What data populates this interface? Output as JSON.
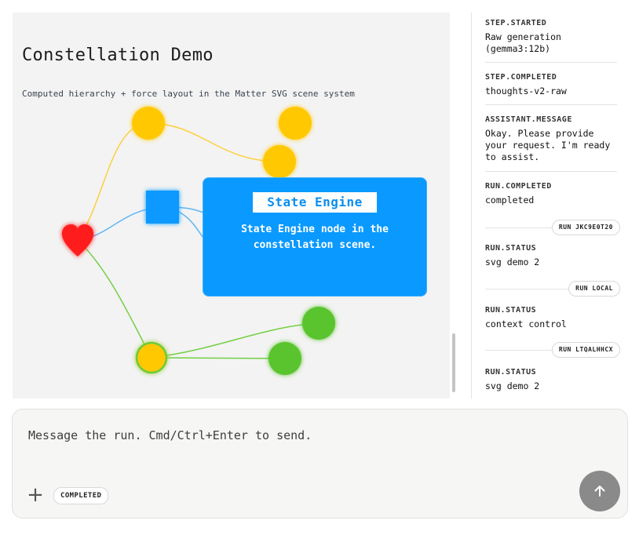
{
  "scene": {
    "title": "Constellation Demo",
    "subtitle": "Computed hierarchy + force layout in the Matter SVG scene system",
    "tooltip": {
      "title": "State Engine",
      "body": "State Engine node in the constellation scene."
    },
    "colors": {
      "yellow": "#ffc800",
      "blue": "#0a99ff",
      "green": "#5ac42e",
      "red": "#ff1a1a",
      "yellow_edge": "#ffcf3d",
      "blue_edge": "#5fb6f5",
      "green_edge": "#73cf45"
    }
  },
  "events": [
    {
      "type": "STEP.STARTED",
      "text": "Raw generation (gemma3:12b)"
    },
    {
      "type": "STEP.COMPLETED",
      "text": "thoughts-v2-raw"
    },
    {
      "type": "ASSISTANT.MESSAGE",
      "text": "Okay. Please provide your request. I'm ready to assist."
    },
    {
      "type": "RUN.COMPLETED",
      "text": "completed"
    },
    {
      "run": "RUN JKC9E0T20"
    },
    {
      "type": "RUN.STATUS",
      "text": "svg demo 2"
    },
    {
      "run": "RUN LOCAL"
    },
    {
      "type": "RUN.STATUS",
      "text": "context control"
    },
    {
      "run": "RUN LTQALHHCX"
    },
    {
      "type": "RUN.STATUS",
      "text": "svg demo 2"
    }
  ],
  "composer": {
    "placeholder": "Message the run. Cmd/Ctrl+Enter to send.",
    "add_icon": "plus-icon",
    "status": "COMPLETED",
    "send_icon": "arrow-up-icon"
  }
}
